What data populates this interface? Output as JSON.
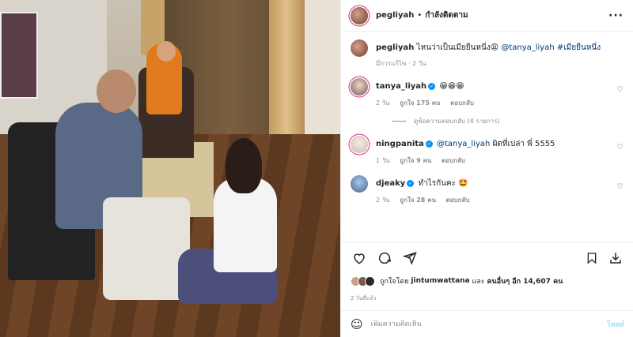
{
  "header": {
    "username": "pegliyah",
    "separator": "•",
    "follow_label": "กำลังติดตาม",
    "more_icon": "more-horizontal-icon"
  },
  "caption": {
    "username": "pegliyah",
    "text": "ไหนว่าเป็นเมียยืนหนึ่ง😩",
    "mention": "@tanya_liyah",
    "hashtag": "#เมียยืนหนึ่ง",
    "edited": "มีการแก้ไข · 2 วัน"
  },
  "comments": [
    {
      "username": "tanya_liyah",
      "verified": true,
      "text": "😁😁😁",
      "time": "2 วัน",
      "likes": "ถูกใจ 175 คน",
      "reply": "ตอบกลับ",
      "view_replies": "ดูข้อความตอบกลับ (4 รายการ)"
    },
    {
      "username": "ningpanita",
      "verified": true,
      "mention": "@tanya_liyah",
      "text": "ผิดที่เปล่า พี่ 5555",
      "time": "1 วัน",
      "likes": "ถูกใจ 9 คน",
      "reply": "ตอบกลับ"
    },
    {
      "username": "djeaky",
      "verified": true,
      "text": "ทำไรกันคะ 🤩",
      "time": "2 วัน",
      "likes": "ถูกใจ 28 คน",
      "reply": "ตอบกลับ"
    }
  ],
  "likes": {
    "prefix": "ถูกใจโดย",
    "user": "jintumwattana",
    "and": "และ",
    "others": "คนอื่นๆ อีก 14,607 คน"
  },
  "posted": "2 วันที่แล้ว",
  "add_comment": {
    "placeholder": "เพิ่มความคิดเห็น",
    "post_label": "โพสต์"
  },
  "colors": {
    "link": "#00376b",
    "verified": "#0095f6",
    "muted": "#8e8e8e",
    "post_disabled": "#b2dffc"
  }
}
